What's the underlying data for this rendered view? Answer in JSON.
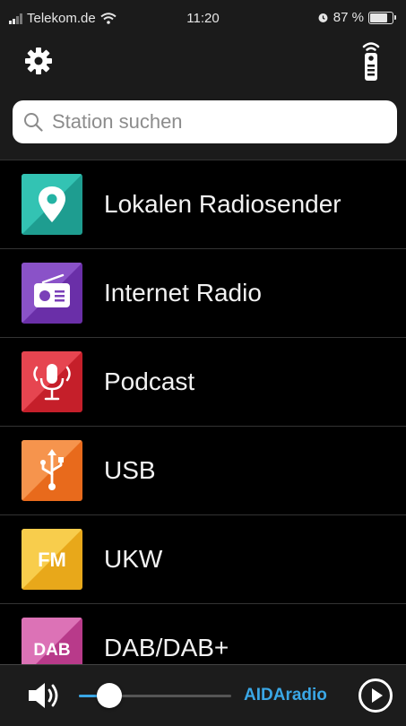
{
  "status_bar": {
    "carrier": "Telekom.de",
    "time": "11:20",
    "battery_text": "87 %"
  },
  "toolbar": {
    "settings_icon": "gear-icon",
    "remote_icon": "remote-control-icon"
  },
  "search": {
    "placeholder": "Station suchen",
    "value": ""
  },
  "sources": [
    {
      "label": "Lokalen Radiosender",
      "icon": "location-pin-icon",
      "color": "#24b3a4"
    },
    {
      "label": "Internet Radio",
      "icon": "radio-icon",
      "color": "#7a3fb8"
    },
    {
      "label": "Podcast",
      "icon": "microphone-icon",
      "color": "#d92a35"
    },
    {
      "label": "USB",
      "icon": "usb-icon",
      "color": "#f07a2c"
    },
    {
      "label": "UKW",
      "icon": "fm-icon",
      "color": "#f0b82a",
      "icon_text": "FM"
    },
    {
      "label": "DAB/DAB+",
      "icon": "dab-icon",
      "color": "#c84a9a",
      "icon_text": "DAB"
    }
  ],
  "player": {
    "volume": 0.2,
    "brand": "AIDAradio",
    "accent": "#3aa7e6",
    "speaker_icon": "speaker-icon",
    "play_icon": "play-icon"
  }
}
